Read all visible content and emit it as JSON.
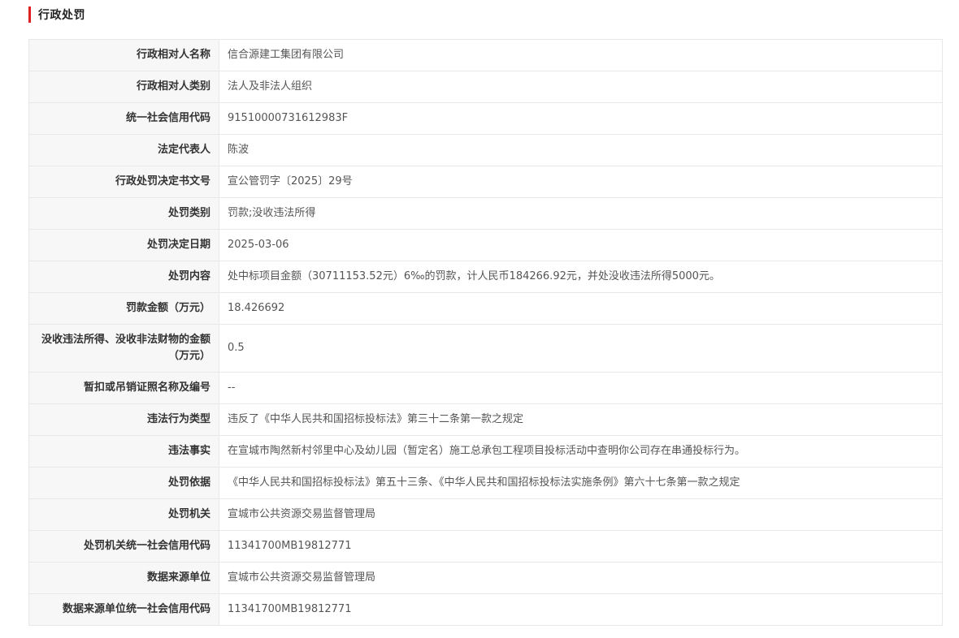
{
  "section": {
    "title": "行政处罚",
    "accent_color": "#e02020"
  },
  "rows": [
    {
      "label": "行政相对人名称",
      "value": "信合源建工集团有限公司"
    },
    {
      "label": "行政相对人类别",
      "value": "法人及非法人组织"
    },
    {
      "label": "统一社会信用代码",
      "value": "91510000731612983F"
    },
    {
      "label": "法定代表人",
      "value": "陈波"
    },
    {
      "label": "行政处罚决定书文号",
      "value": "宣公管罚字〔2025〕29号"
    },
    {
      "label": "处罚类别",
      "value": "罚款;没收违法所得"
    },
    {
      "label": "处罚决定日期",
      "value": "2025-03-06"
    },
    {
      "label": "处罚内容",
      "value": "处中标项目金额（30711153.52元）6‰的罚款，计人民币184266.92元，并处没收违法所得5000元。"
    },
    {
      "label": "罚款金额（万元）",
      "value": "18.426692"
    },
    {
      "label": "没收违法所得、没收非法财物的金额（万元）",
      "value": "0.5"
    },
    {
      "label": "暂扣或吊销证照名称及编号",
      "value": "--"
    },
    {
      "label": "违法行为类型",
      "value": "违反了《中华人民共和国招标投标法》第三十二条第一款之规定"
    },
    {
      "label": "违法事实",
      "value": "在宣城市陶然新村邻里中心及幼儿园（暂定名）施工总承包工程项目投标活动中查明你公司存在串通投标行为。"
    },
    {
      "label": "处罚依据",
      "value": "《中华人民共和国招标投标法》第五十三条、《中华人民共和国招标投标法实施条例》第六十七条第一款之规定"
    },
    {
      "label": "处罚机关",
      "value": "宣城市公共资源交易监督管理局"
    },
    {
      "label": "处罚机关统一社会信用代码",
      "value": "11341700MB19812771"
    },
    {
      "label": "数据来源单位",
      "value": "宣城市公共资源交易监督管理局"
    },
    {
      "label": "数据来源单位统一社会信用代码",
      "value": "11341700MB19812771"
    }
  ]
}
